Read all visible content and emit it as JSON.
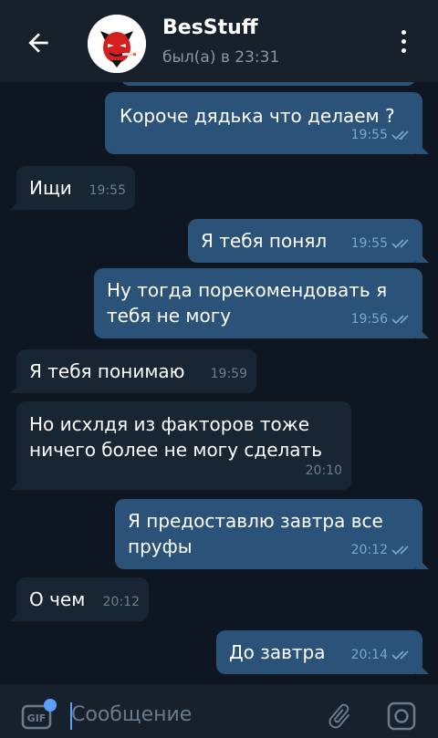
{
  "header": {
    "contact_name": "BesStuff",
    "status": "был(а) в 23:31"
  },
  "messages": [
    {
      "dir": "out",
      "text": "Короче дядька что делаем ?",
      "time": "19:55"
    },
    {
      "dir": "in",
      "text": "Ищи",
      "time": "19:55"
    },
    {
      "dir": "out",
      "text": "Я тебя понял",
      "time": "19:55"
    },
    {
      "dir": "out",
      "text": "Ну тогда порекомендовать я тебя не могу",
      "time": "19:56"
    },
    {
      "dir": "in",
      "text": "Я тебя понимаю",
      "time": "19:59"
    },
    {
      "dir": "in",
      "text": "Но исхлдя из факторов тоже ничего более не могу сделать",
      "time": "20:10"
    },
    {
      "dir": "out",
      "text": "Я предоставлю завтра все пруфы",
      "time": "20:12"
    },
    {
      "dir": "in",
      "text": "О чем",
      "time": "20:12"
    },
    {
      "dir": "out",
      "text": "До завтра",
      "time": "20:14"
    }
  ],
  "input": {
    "placeholder": "Сообщение"
  },
  "colors": {
    "background": "#0e1621",
    "header": "#17212b",
    "outgoing_bubble": "#2b5278",
    "incoming_bubble": "#182533",
    "accent": "#5aa0ff"
  },
  "icons": [
    "back-arrow-icon",
    "devil-avatar",
    "more-vert-icon",
    "read-ticks-icon",
    "gif-icon",
    "attach-clip-icon",
    "camera-icon"
  ]
}
